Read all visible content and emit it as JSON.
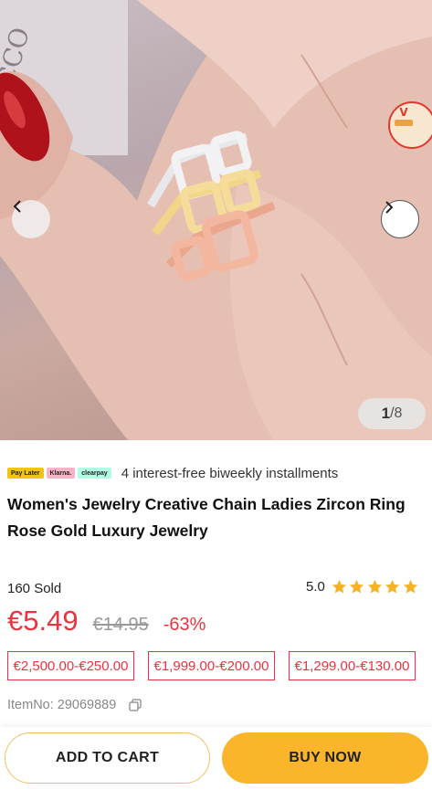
{
  "gallery": {
    "current": "1",
    "total": "/8"
  },
  "payment": {
    "logos": [
      "Pay Later",
      "Klarna.",
      "clearpay"
    ],
    "text": "4 interest-free biweekly installments"
  },
  "product": {
    "title": "Women's Jewelry Creative Chain Ladies Zircon Ring Rose Gold Luxury Jewelry",
    "sold": "160 Sold",
    "rating_score": "5.0",
    "stars": 5,
    "price": "€5.49",
    "old_price": "€14.95",
    "discount": "-63%",
    "coupons": [
      "€2,500.00-€250.00",
      "€1,999.00-€200.00",
      "€1,299.00-€130.00"
    ],
    "item_no": "ItemNo: 29069889"
  },
  "actions": {
    "add_to_cart": "ADD TO CART",
    "buy_now": "BUY NOW"
  },
  "colors": {
    "price_red": "#e8343f",
    "buy_yellow": "#fbb52a",
    "star_gold": "#f5b324"
  }
}
